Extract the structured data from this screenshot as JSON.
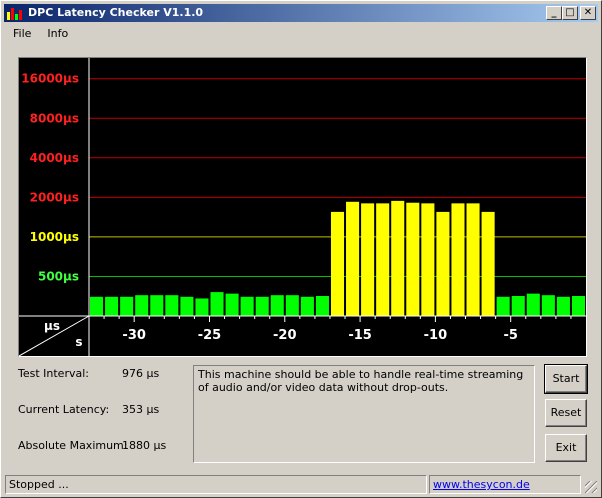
{
  "window": {
    "title": "DPC Latency Checker V1.1.0",
    "minimize_glyph": "_",
    "maximize_glyph": "□",
    "close_glyph": "✕"
  },
  "menu": [
    "File",
    "Info"
  ],
  "chart_data": {
    "type": "bar",
    "yaxis_labels": [
      {
        "text": "16000µs",
        "value": 16000,
        "color": "#ff2020"
      },
      {
        "text": "8000µs",
        "value": 8000,
        "color": "#ff2020"
      },
      {
        "text": "4000µs",
        "value": 4000,
        "color": "#ff2020"
      },
      {
        "text": "2000µs",
        "value": 2000,
        "color": "#ff2020"
      },
      {
        "text": "1000µs",
        "value": 1000,
        "color": "#ffff00"
      },
      {
        "text": "500µs",
        "value": 500,
        "color": "#40ff40"
      }
    ],
    "x_ticks": [
      -30,
      -25,
      -20,
      -15,
      -10,
      -5
    ],
    "corner_unit_top": "µs",
    "corner_unit_bottom": "s",
    "xlim": [
      -33,
      0
    ],
    "y_log_scale": true,
    "ylim": [
      250,
      23000
    ],
    "green_threshold": 1000,
    "bars": [
      {
        "x": -32.5,
        "value": 350
      },
      {
        "x": -31.5,
        "value": 350
      },
      {
        "x": -30.5,
        "value": 350
      },
      {
        "x": -29.5,
        "value": 360
      },
      {
        "x": -28.5,
        "value": 360
      },
      {
        "x": -27.5,
        "value": 360
      },
      {
        "x": -26.5,
        "value": 350
      },
      {
        "x": -25.5,
        "value": 340
      },
      {
        "x": -24.5,
        "value": 380
      },
      {
        "x": -23.5,
        "value": 370
      },
      {
        "x": -22.5,
        "value": 350
      },
      {
        "x": -21.5,
        "value": 350
      },
      {
        "x": -20.5,
        "value": 360
      },
      {
        "x": -19.5,
        "value": 360
      },
      {
        "x": -18.5,
        "value": 350
      },
      {
        "x": -17.5,
        "value": 355
      },
      {
        "x": -16.5,
        "value": 1550
      },
      {
        "x": -15.5,
        "value": 1850
      },
      {
        "x": -14.5,
        "value": 1800
      },
      {
        "x": -13.5,
        "value": 1800
      },
      {
        "x": -12.5,
        "value": 1880
      },
      {
        "x": -11.5,
        "value": 1820
      },
      {
        "x": -10.5,
        "value": 1800
      },
      {
        "x": -9.5,
        "value": 1550
      },
      {
        "x": -8.5,
        "value": 1800
      },
      {
        "x": -7.5,
        "value": 1800
      },
      {
        "x": -6.5,
        "value": 1550
      },
      {
        "x": -5.5,
        "value": 350
      },
      {
        "x": -4.5,
        "value": 355
      },
      {
        "x": -3.5,
        "value": 370
      },
      {
        "x": -2.5,
        "value": 360
      },
      {
        "x": -1.5,
        "value": 350
      },
      {
        "x": -0.5,
        "value": 355
      }
    ],
    "colors": {
      "background": "#000000",
      "green": "#00ff00",
      "yellow": "#ffff00",
      "red_line": "#c00000",
      "yellow_line": "#c0c000",
      "green_line": "#00c000"
    }
  },
  "stats": {
    "test_interval_label": "Test Interval:",
    "test_interval_value": "976 µs",
    "current_latency_label": "Current Latency:",
    "current_latency_value": "353 µs",
    "absolute_max_label": "Absolute Maximum:",
    "absolute_max_value": "1880 µs"
  },
  "message": "This machine should be able to handle real-time streaming of audio and/or video data without drop-outs.",
  "buttons": {
    "start": "Start",
    "reset": "Reset",
    "exit": "Exit"
  },
  "status": {
    "text": "Stopped ...",
    "link": "www.thesycon.de"
  }
}
